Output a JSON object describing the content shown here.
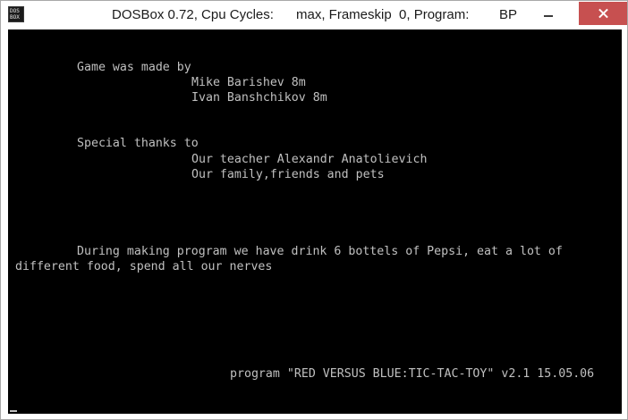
{
  "window": {
    "title_app": "DOSBox 0.72, Cpu Cycles:",
    "title_cycles": "max, Frameskip  0, Program:",
    "title_program": "BP",
    "icon_line1": "DOS",
    "icon_line2": "BOX",
    "accent_close": "#c75050"
  },
  "screen": {
    "background": "#000000",
    "text_color": "#c0c0c0",
    "lines": {
      "made_by": "Game was made by",
      "author1": "Mike Barishev 8m",
      "author2": "Ivan Banshchikov 8m",
      "thanks": "Special thanks to",
      "thanks1": "Our teacher Alexandr Anatolievich",
      "thanks2": "Our family,friends and pets",
      "story1": "During making program we have drink 6 bottels of Pepsi, eat a lot of",
      "story2": "different food, spend all our nerves",
      "footer": "program \"RED VERSUS BLUE:TIC-TAC-TOY\" v2.1 15.05.06"
    }
  }
}
